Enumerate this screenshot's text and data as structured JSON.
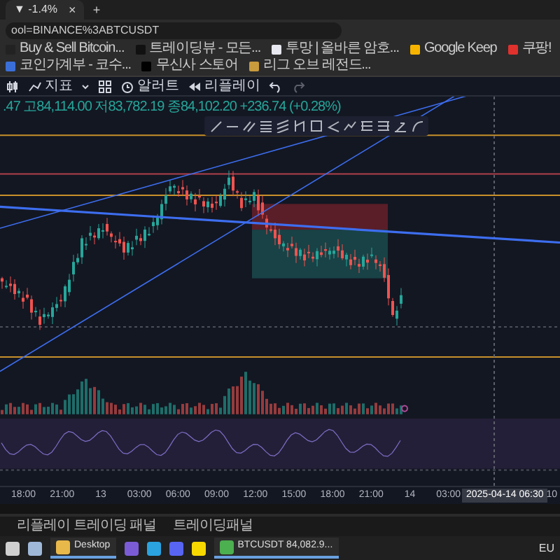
{
  "browser": {
    "tab": {
      "title": "▼ -1.4%",
      "close": "×"
    },
    "new_tab": "+",
    "address": "ool=BINANCE%3ABTCUSDT",
    "bookmarks": [
      {
        "label": "Buy & Sell Bitcoin...",
        "color": "#222222"
      },
      {
        "label": "트레이딩뷰 - 모든...",
        "color": "#111111"
      },
      {
        "label": "투망 | 올바른 암호...",
        "color": "#e8e8f0"
      },
      {
        "label": "Google Keep",
        "color": "#f6b400"
      },
      {
        "label": "쿠팡!",
        "color": "#e0312d"
      },
      {
        "label": "코인가계부 - 코수...",
        "color": "#3b6fd8"
      },
      {
        "label": "무신사 스토어",
        "color": "#000000"
      },
      {
        "label": "리그 오브 레전드...",
        "color": "#c89b3c"
      }
    ]
  },
  "chart_toolbar": {
    "buttons": [
      {
        "kind": "indicators",
        "label": "지표"
      },
      {
        "kind": "alert",
        "label": "알러트"
      },
      {
        "kind": "replay",
        "label": "리플레이"
      }
    ]
  },
  "legend": ".47 고84,114.00 저83,782.19 종84,102.20 +236.74 (+0.28%)",
  "x_axis": {
    "labels": [
      "18:00",
      "21:00",
      "13",
      "03:00",
      "06:00",
      "09:00",
      "12:00",
      "15:00",
      "18:00",
      "21:00",
      "14",
      "03:00"
    ],
    "cursor_label": "2025-04-14  06:30",
    "edge_label": "10"
  },
  "bottom_panel": {
    "tabs": [
      "리플레이 트레이딩 패널",
      "트레이딩패널"
    ]
  },
  "taskbar": {
    "items": [
      {
        "kind": "icon",
        "color": "#cfcfcf"
      },
      {
        "kind": "icon",
        "color": "#9fb8d8"
      },
      {
        "kind": "window",
        "label": "Desktop",
        "color": "#e8b84a"
      },
      {
        "kind": "icon",
        "color": "#7b5cd6"
      },
      {
        "kind": "icon",
        "color": "#2aa3e0"
      },
      {
        "kind": "icon",
        "color": "#5865f2"
      },
      {
        "kind": "icon",
        "color": "#f7d900"
      },
      {
        "kind": "window",
        "label": "BTCUSDT 84,082.9...",
        "color": "#4caf50"
      }
    ],
    "tray": "EU"
  }
}
